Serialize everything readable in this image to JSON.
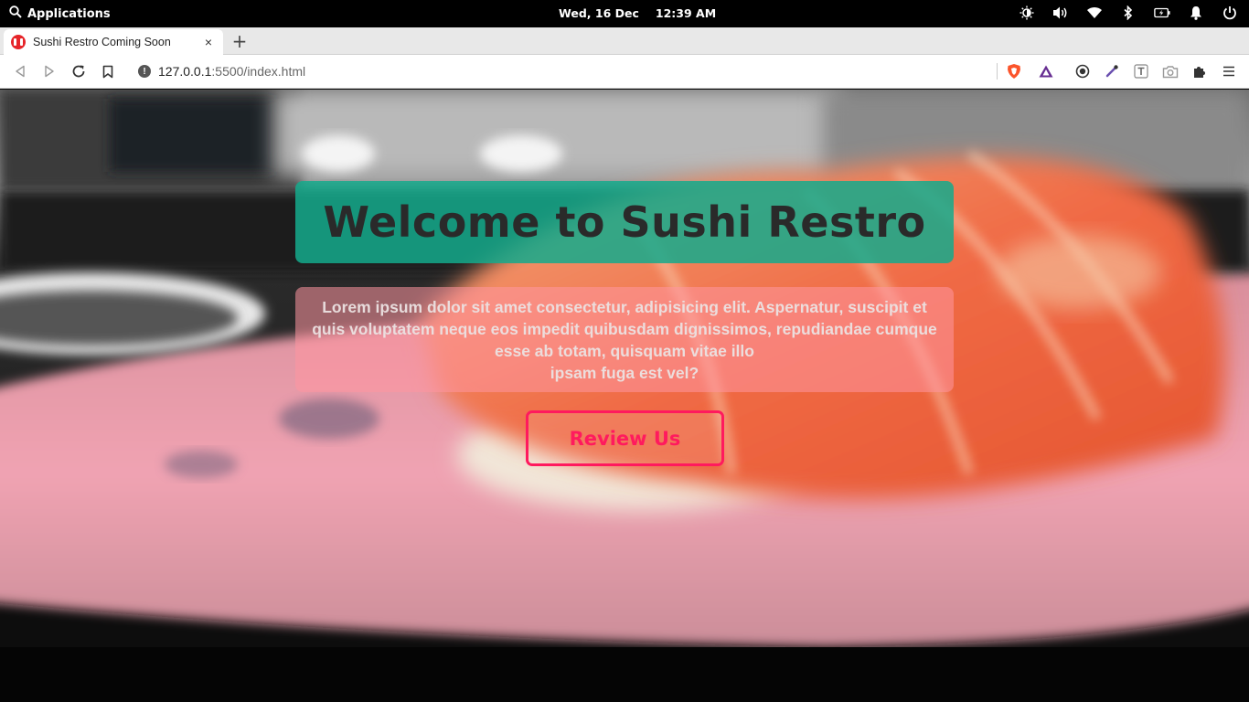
{
  "topbar": {
    "applications_label": "Applications",
    "date": "Wed, 16 Dec",
    "time": "12:39 AM",
    "tray_icons": [
      "brightness-icon",
      "volume-icon",
      "wifi-icon",
      "bluetooth-icon",
      "battery-icon",
      "notification-bell-icon",
      "power-icon"
    ]
  },
  "browser": {
    "tab": {
      "title": "Sushi Restro Coming Soon",
      "close": "×"
    },
    "new_tab": "+",
    "url": {
      "host": "127.0.0.1",
      "path": ":5500/index.html",
      "info": "!"
    },
    "extension_icons": [
      "brave-shields-icon",
      "brave-rewards-icon",
      "record-icon",
      "color-picker-icon",
      "text-extension-icon",
      "screenshot-icon",
      "extensions-puzzle-icon",
      "menu-icon"
    ]
  },
  "page": {
    "title": "Welcome to Sushi Restro",
    "description_line1": "Lorem ipsum dolor sit amet consectetur, adipisicing elit. Aspernatur, suscipit et quis voluptatem neque eos impedit quibusdam dignissimos, repudiandae cumque esse ab totam, quisquam vitae illo",
    "description_line2": "ipsam fuga est vel?",
    "button_label": "Review Us"
  },
  "colors": {
    "title_bg": "#14aa8c",
    "text_box_bg": "#ff96a0",
    "button_accent": "#ff1a5e"
  }
}
